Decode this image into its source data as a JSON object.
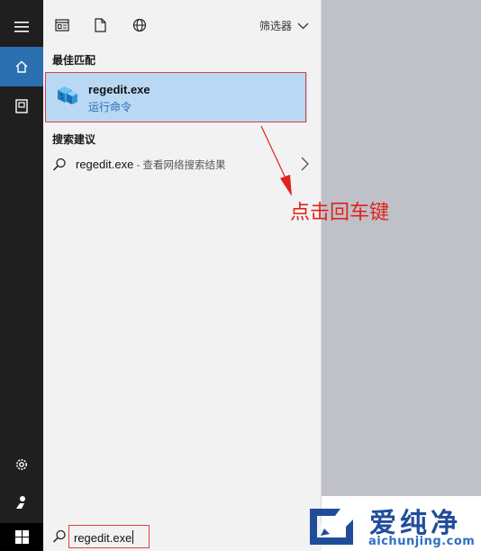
{
  "rail": {
    "items": [
      {
        "icon": "hamburger-menu-icon"
      },
      {
        "icon": "home-icon",
        "active": true
      },
      {
        "icon": "document-icon"
      },
      {
        "icon": "settings-gear-icon"
      },
      {
        "icon": "user-icon"
      }
    ]
  },
  "toolbar": {
    "icons": [
      "apps-filter-icon",
      "documents-filter-icon",
      "web-filter-icon"
    ],
    "filter_label": "筛选器"
  },
  "best_match": {
    "heading": "最佳匹配",
    "title": "regedit.exe",
    "subtitle": "运行命令",
    "icon": "regedit-app-icon"
  },
  "suggestions": {
    "heading": "搜索建议",
    "items": [
      {
        "query": "regedit.exe",
        "hint": " - 查看网络搜索结果"
      }
    ]
  },
  "search": {
    "value": "regedit.exe"
  },
  "annotation": {
    "text": "点击回车键",
    "color": "#e0231f"
  },
  "watermark": {
    "name": "爱纯净",
    "url": "aichunjing.com",
    "color": "#1f4d9a"
  }
}
